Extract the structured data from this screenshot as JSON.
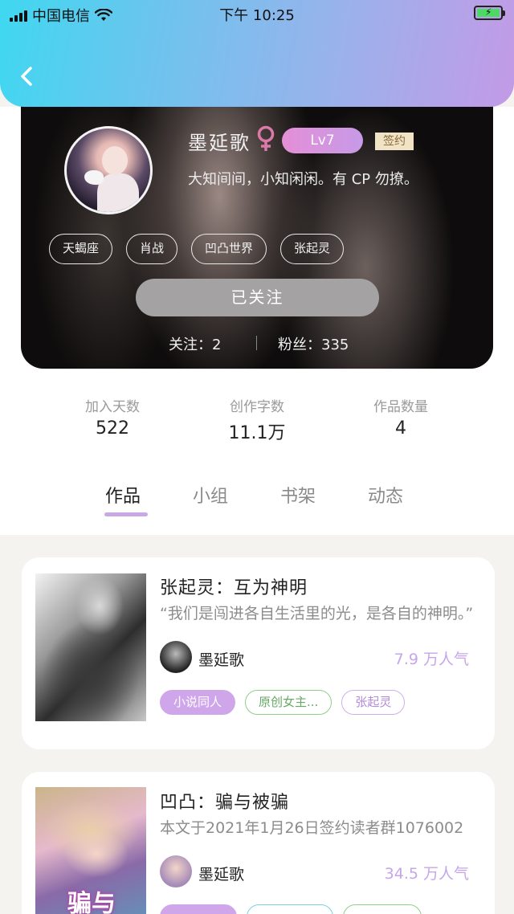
{
  "status_bar": {
    "carrier": "中国电信",
    "time": "下午 10:25"
  },
  "icons": {
    "back": "chevron-left-icon",
    "wifi": "wifi-icon",
    "battery": "battery-charging-icon",
    "gender": "female-icon"
  },
  "colors": {
    "accent": "#c9a8e6",
    "header_gradient_start": "#3fd8f0",
    "header_gradient_end": "#c39ae6",
    "popularity": "#c6a6ea"
  },
  "profile": {
    "name": "墨延歌",
    "level": "Lv7",
    "signed": "签约",
    "bio": "大知间间，小知闲闲。有 CP 勿撩。",
    "tags": [
      "天蝎座",
      "肖战",
      "凹凸世界",
      "张起灵"
    ],
    "follow_button": "已关注",
    "following_label": "关注：2",
    "fans_label": "粉丝：335"
  },
  "stats": [
    {
      "label": "加入天数",
      "value": "522"
    },
    {
      "label": "创作字数",
      "value": "11.1万"
    },
    {
      "label": "作品数量",
      "value": "4"
    }
  ],
  "tabs": [
    {
      "label": "作品",
      "active": true
    },
    {
      "label": "小组",
      "active": false
    },
    {
      "label": "书架",
      "active": false
    },
    {
      "label": "动态",
      "active": false
    }
  ],
  "works": [
    {
      "title": "张起灵：互为神明",
      "desc": "“我们是闯进各自生活里的光，是各自的神明。”",
      "author": "墨延歌",
      "popularity": "7.9 万人气",
      "tags": [
        "小说同人",
        "原创女主...",
        "张起灵"
      ]
    },
    {
      "title": "凹凸：骗与被骗",
      "desc": "本文于2021年1月26日签约读者群1076002",
      "author": "墨延歌",
      "popularity": "34.5 万人气",
      "cover_text": "骗与"
    }
  ]
}
